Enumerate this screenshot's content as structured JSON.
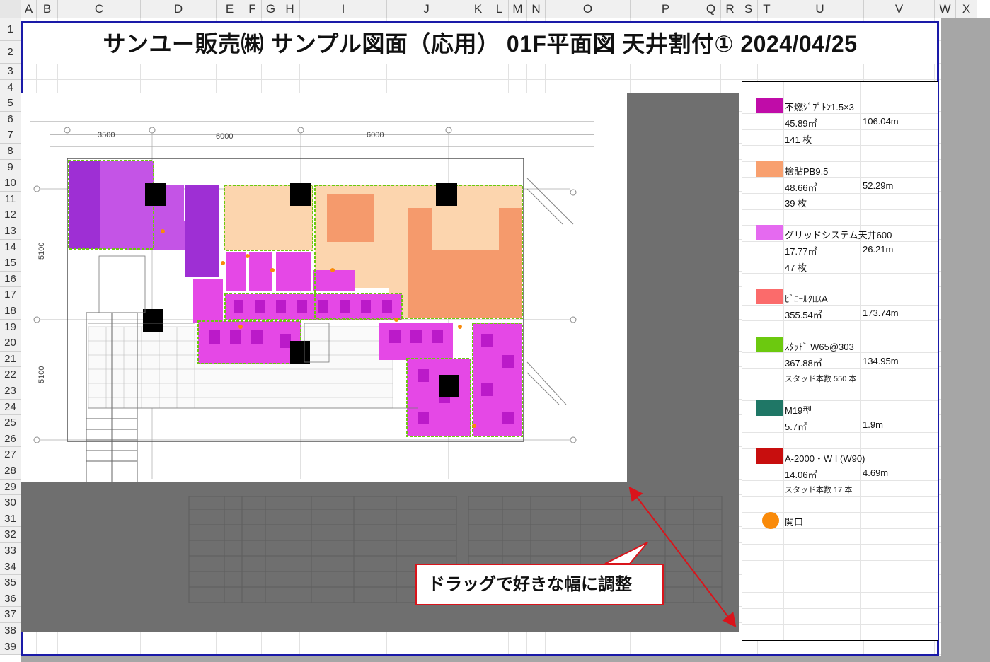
{
  "spreadsheet": {
    "columns": [
      "A",
      "B",
      "C",
      "D",
      "E",
      "F",
      "G",
      "H",
      "I",
      "J",
      "K",
      "L",
      "M",
      "N",
      "O",
      "P",
      "Q",
      "R",
      "S",
      "T",
      "U",
      "V",
      "W",
      "X"
    ],
    "rows": [
      "1",
      "2",
      "3",
      "4",
      "5",
      "6",
      "7",
      "8",
      "9",
      "10",
      "11",
      "12",
      "13",
      "14",
      "15",
      "16",
      "17",
      "18",
      "19",
      "20",
      "21",
      "22",
      "23",
      "24",
      "25",
      "26",
      "27",
      "28",
      "29",
      "30",
      "31",
      "32",
      "33",
      "34",
      "35",
      "36",
      "37",
      "38",
      "39"
    ]
  },
  "header": {
    "title": "サンユー販売㈱ サンプル図面（応用） 01F平面図 天井割付① 2024/04/25"
  },
  "plan": {
    "dim_top": [
      "3500",
      "6000",
      "6000"
    ],
    "dim_left": [
      "5100",
      "5100"
    ]
  },
  "legend": {
    "items": [
      {
        "name": "不燃ｼﾞﾌﾟﾄﾝ1.5×3",
        "area": "45.89㎡",
        "length": "106.04m",
        "count": "141 枚",
        "color": "#c00ca8"
      },
      {
        "name": "捨貼PB9.5",
        "area": "48.66㎡",
        "length": "52.29m",
        "count": "39 枚",
        "color": "#f8a06f"
      },
      {
        "name": "グリッドシステム天井600",
        "area": "17.77㎡",
        "length": "26.21m",
        "count": "47 枚",
        "color": "#e56af0"
      },
      {
        "name": "ﾋﾞﾆｰﾙｸﾛｽA",
        "area": "355.54㎡",
        "length": "173.74m",
        "count": "",
        "color": "#fb6b6b"
      },
      {
        "name": "ｽﾀｯﾄﾞ W65@303",
        "area": "367.88㎡",
        "length": "134.95m",
        "count": "スタッド本数 550 本",
        "color": "#6cc90f"
      },
      {
        "name": "M19型",
        "area": "5.7㎡",
        "length": "1.9m",
        "count": "",
        "color": "#1f7766"
      },
      {
        "name": "A-2000・W I (W90)",
        "area": "14.06㎡",
        "length": "4.69m",
        "count": "スタッド本数 17 本",
        "color": "#c80e0e"
      },
      {
        "name": "開口",
        "area": "",
        "length": "",
        "count": "",
        "color": "#f98a0a"
      }
    ]
  },
  "callout": {
    "text": "ドラッグで好きな幅に調整"
  }
}
